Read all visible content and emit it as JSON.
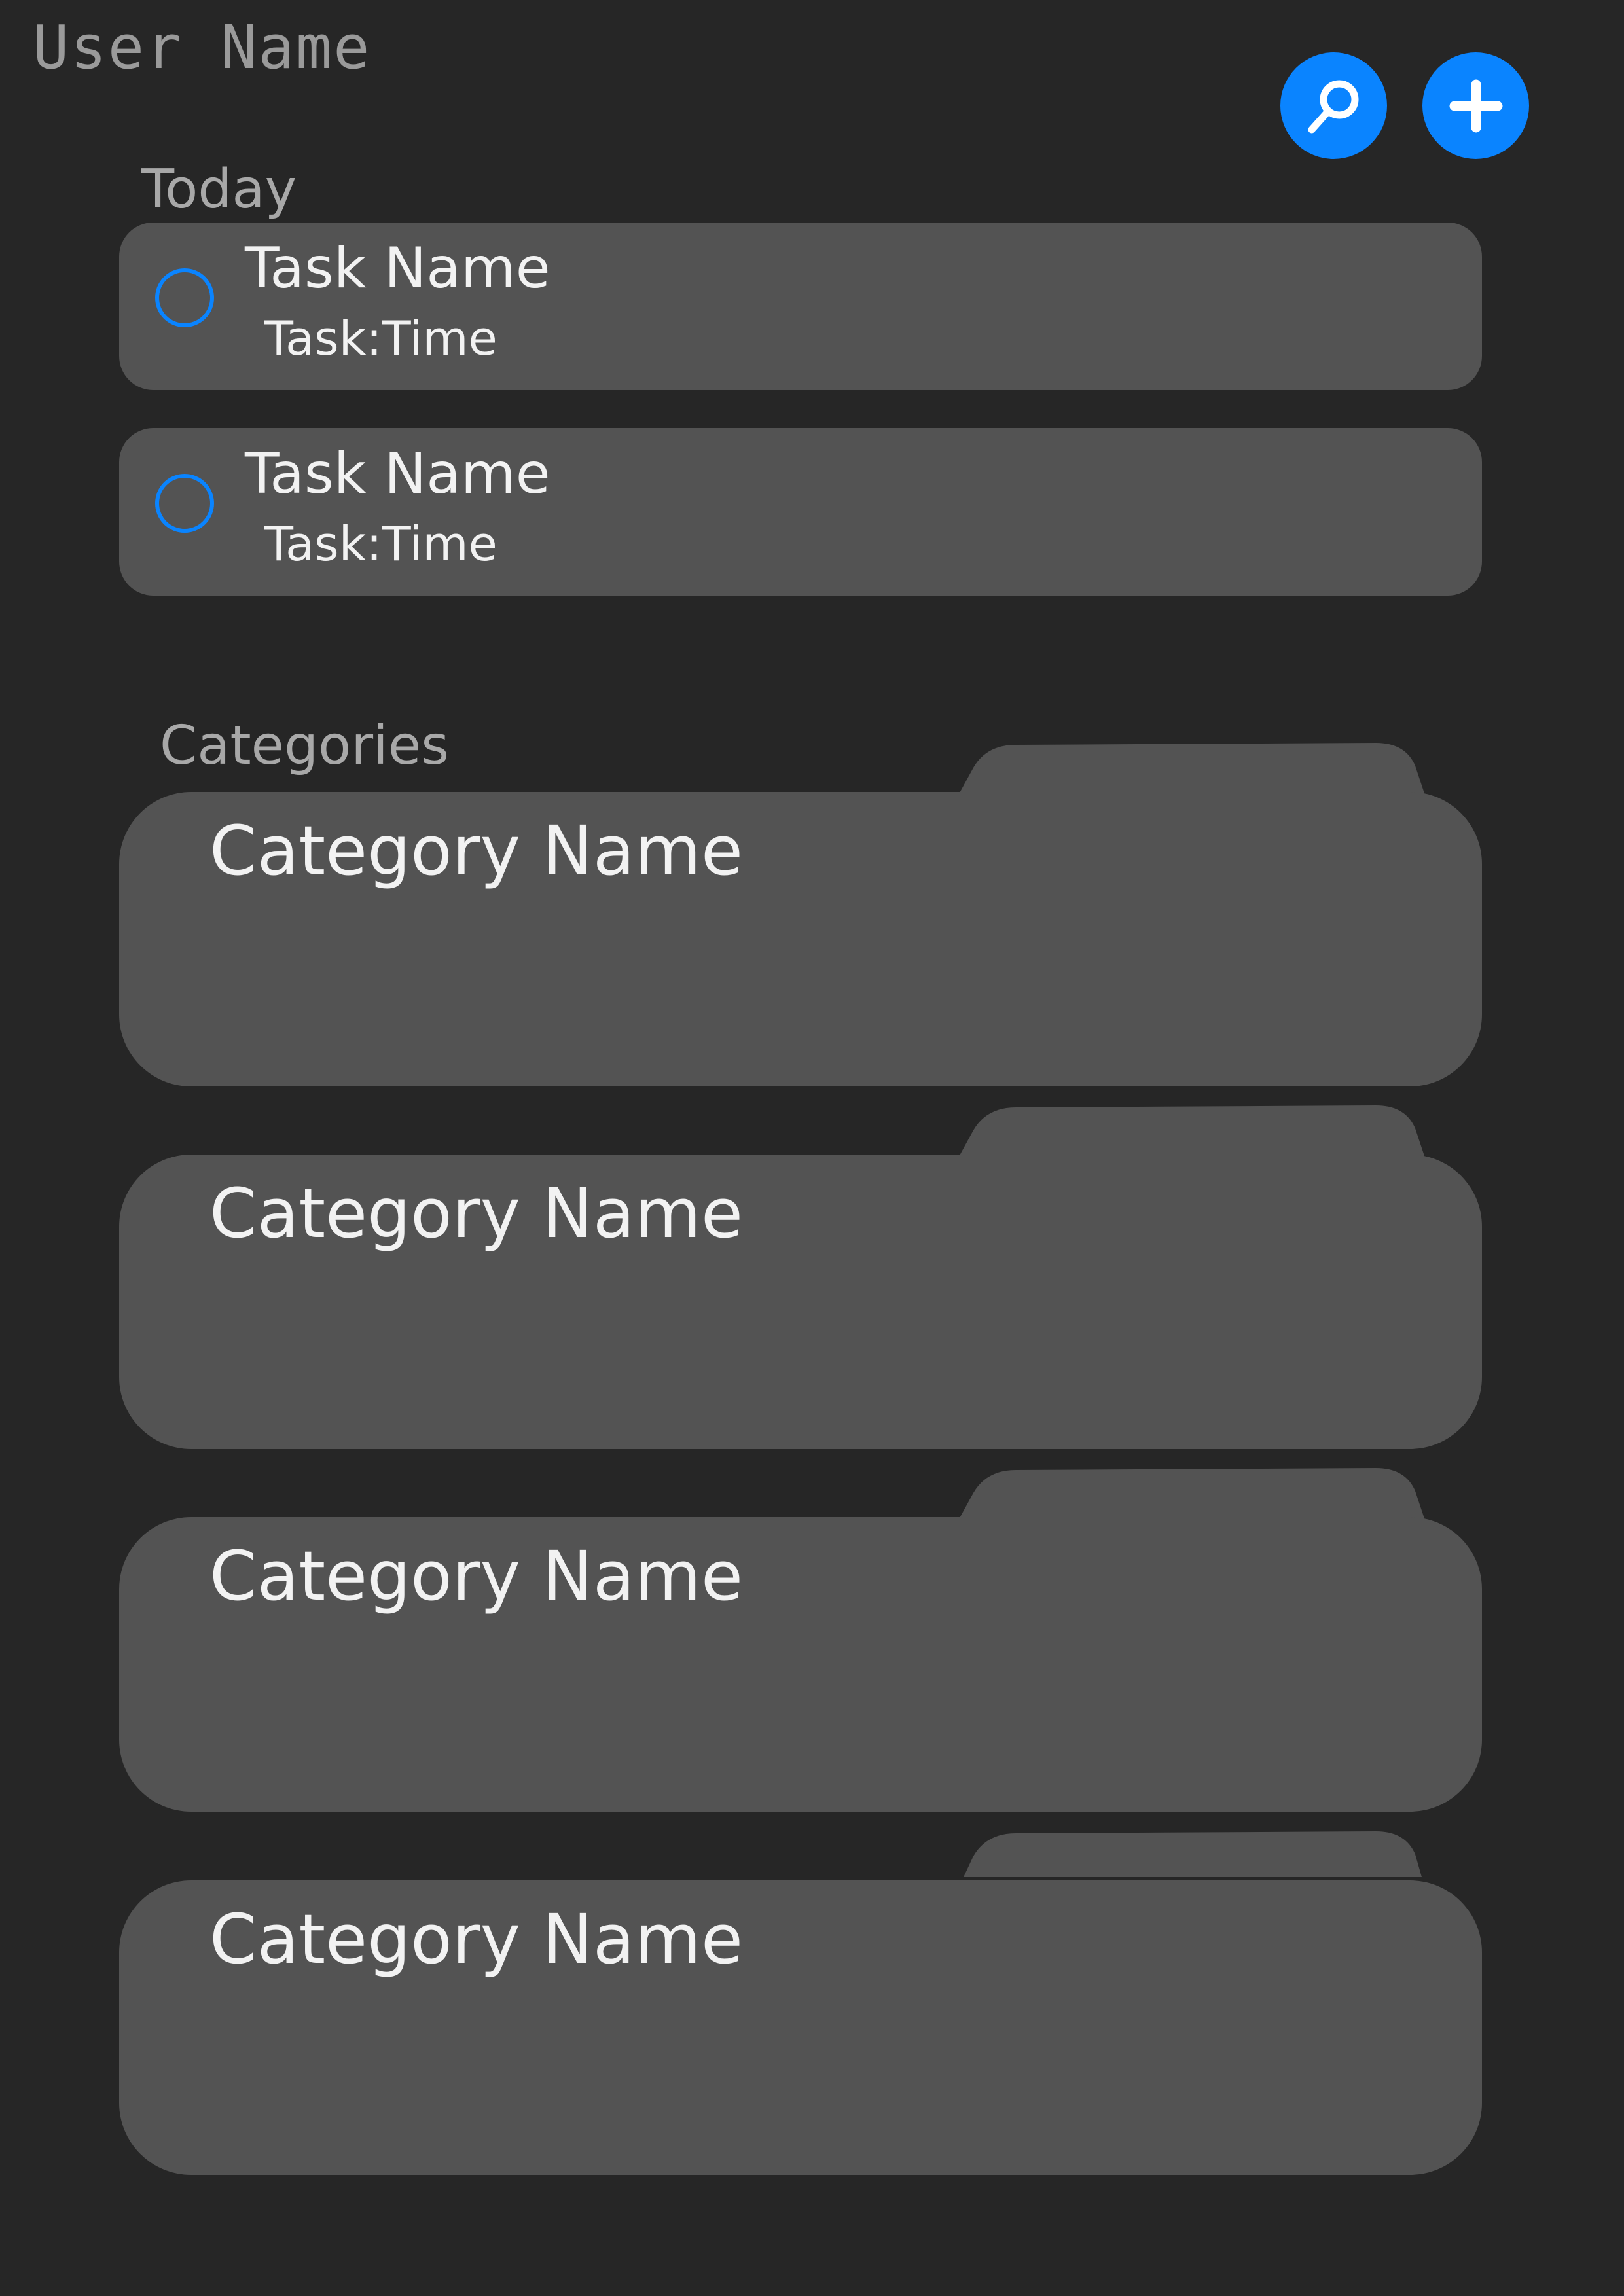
{
  "header": {
    "user_name": "User Name",
    "search_icon": "search-icon",
    "add_icon": "plus-icon"
  },
  "today": {
    "label": "Today",
    "tasks": [
      {
        "name": "Task Name",
        "time": "Task:Time"
      },
      {
        "name": "Task Name",
        "time": "Task:Time"
      }
    ]
  },
  "categories": {
    "label": "Categories",
    "items": [
      {
        "name": "Category Name"
      },
      {
        "name": "Category Name"
      },
      {
        "name": "Category Name"
      },
      {
        "name": "Category Name"
      }
    ]
  },
  "colors": {
    "background": "#262626",
    "card": "#535353",
    "accent": "#0a84ff",
    "text": "#f2f2f2",
    "muted_text": "#a8a8a8"
  }
}
